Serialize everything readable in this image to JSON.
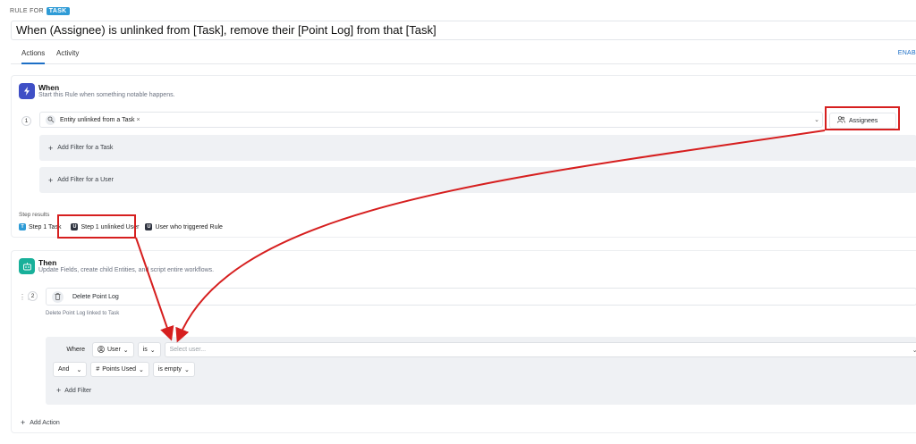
{
  "header": {
    "rule_for_label": "RULE FOR",
    "rule_for_badge": "TASK",
    "title": "When (Assignee) is unlinked from [Task], remove their [Point Log] from that [Task]",
    "enable_label": "ENAB"
  },
  "tabs": [
    {
      "label": "Actions",
      "active": true
    },
    {
      "label": "Activity",
      "active": false
    }
  ],
  "when": {
    "title": "When",
    "subtitle": "Start this Rule when something notable happens.",
    "step_number": "1",
    "trigger": "Entity unlinked from a Task",
    "trigger_remove": "×",
    "target_button": "Assignees",
    "filters": [
      "Add Filter for a Task",
      "Add Filter for a User"
    ],
    "step_results_label": "Step results",
    "step_results": [
      {
        "badge": "T",
        "label": "Step 1 Task"
      },
      {
        "badge": "U",
        "label": "Step 1 unlinked User"
      },
      {
        "badge": "U",
        "label": "User who triggered Rule"
      }
    ]
  },
  "then": {
    "title": "Then",
    "subtitle": "Update Fields, create child Entities, and script entire workflows.",
    "step_number": "2",
    "action": "Delete Point Log",
    "action_description": "Delete Point Log linked to Task",
    "where_label": "Where",
    "where_field": "User",
    "where_operator": "is",
    "where_value_placeholder": "Select user...",
    "and_label": "And",
    "and_field": "Points Used",
    "and_operator": "is empty",
    "add_filter": "Add Filter",
    "add_action": "Add Action"
  },
  "annotation_color": "#d61f1f"
}
